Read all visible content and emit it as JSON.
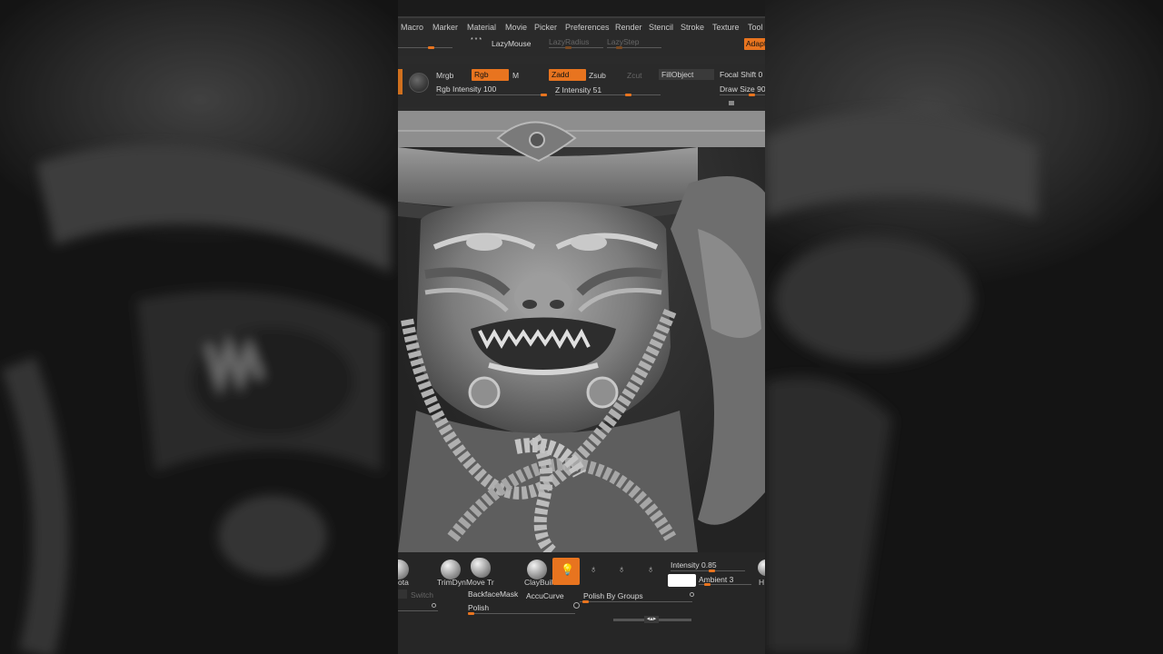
{
  "menu": [
    "Macro",
    "Marker",
    "Material",
    "Movie",
    "Picker",
    "Preferences",
    "Render",
    "Stencil",
    "Stroke",
    "Texture",
    "Tool"
  ],
  "lazy": {
    "lazymouse": "LazyMouse",
    "lazyradius": "LazyRadius",
    "lazystep": "LazyStep",
    "adapt": "Adapt"
  },
  "toolbar": {
    "mrgb": "Mrgb",
    "rgb": "Rgb",
    "m": "M",
    "zadd": "Zadd",
    "zsub": "Zsub",
    "zcut": "Zcut",
    "fillobject": "FillObject",
    "focal_shift_label": "Focal Shift",
    "focal_shift_value": "0",
    "rgb_intensity_label": "Rgb Intensity",
    "rgb_intensity_value": "100",
    "z_intensity_label": "Z Intensity",
    "z_intensity_value": "51",
    "draw_size_label": "Draw Size",
    "draw_size_value": "90"
  },
  "bottom": {
    "brush_rota": "ota",
    "brush_trimdyn": "TrimDyn",
    "brush_move": "Move Tr",
    "brush_claybuild": "ClayBuil",
    "intensity_label": "Intensity",
    "intensity_value": "0.85",
    "ambient_label": "Ambient",
    "ambient_value": "3",
    "switch": "Switch",
    "backfacemask": "BackfaceMask",
    "accucurve": "AccuCurve",
    "polish_by_groups": "Polish By Groups",
    "polish": "Polish",
    "h": "H"
  },
  "colors": {
    "accent": "#e8741f",
    "panel": "#2a2a2a"
  }
}
